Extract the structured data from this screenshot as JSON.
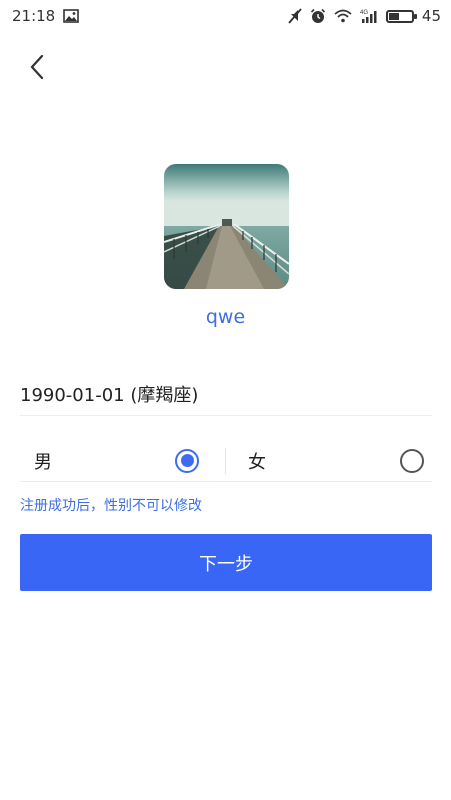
{
  "status_bar": {
    "time": "21:18",
    "battery_level": "45",
    "battery_fraction": 0.45,
    "icons": [
      "image-icon",
      "mute-icon",
      "alarm-icon",
      "wifi-icon",
      "signal-4g-icon"
    ]
  },
  "header": {
    "back_icon": "back-chevron-icon"
  },
  "profile": {
    "username": "qwe"
  },
  "form": {
    "birthday": "1990-01-01 (摩羯座)",
    "gender": {
      "male_label": "男",
      "female_label": "女",
      "selected": "male"
    },
    "gender_note": "注册成功后，性别不可以修改",
    "next_label": "下一步"
  },
  "colors": {
    "accent": "#3a66f5",
    "link": "#3d6fe0"
  }
}
